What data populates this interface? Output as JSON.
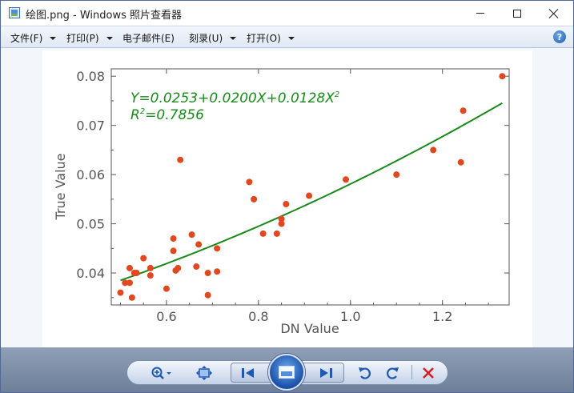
{
  "window": {
    "title": "绘图.png - Windows 照片查看器"
  },
  "menu": {
    "items": [
      {
        "label": "文件(F)"
      },
      {
        "label": "打印(P)"
      },
      {
        "label": "电子邮件(E)"
      },
      {
        "label": "刻录(U)"
      },
      {
        "label": "打开(O)"
      }
    ]
  },
  "toolbar": {
    "icons": [
      "zoom-icon",
      "fit-window-icon",
      "previous-icon",
      "slideshow-icon",
      "next-icon",
      "rotate-counterclockwise-icon",
      "rotate-clockwise-icon",
      "delete-icon"
    ]
  },
  "chart_data": {
    "type": "scatter",
    "xlabel": "DN Value",
    "ylabel": "True Value",
    "xlim": [
      0.48,
      1.345
    ],
    "ylim": [
      0.0335,
      0.0815
    ],
    "xticks": [
      "0.6",
      "0.8",
      "1.0",
      "1.2"
    ],
    "yticks": [
      "0.04",
      "0.05",
      "0.06",
      "0.07",
      "0.08"
    ],
    "equation": "Y=0.0253+0.0200X+0.0128X",
    "equation_sup": "2",
    "r2_prefix": "R",
    "r2_sup": "2",
    "r2_value": "=0.7856",
    "colors": {
      "points": "#e0491f",
      "fit": "#1a8a1a",
      "annotation": "#1a8a1a",
      "axis": "#555555"
    },
    "fit": {
      "a": 0.0253,
      "b": 0.02,
      "c": 0.0128,
      "x_from": 0.5,
      "x_to": 1.33
    },
    "points": [
      [
        0.5,
        0.036
      ],
      [
        0.51,
        0.038
      ],
      [
        0.52,
        0.041
      ],
      [
        0.52,
        0.038
      ],
      [
        0.525,
        0.035
      ],
      [
        0.53,
        0.04
      ],
      [
        0.535,
        0.04
      ],
      [
        0.55,
        0.043
      ],
      [
        0.565,
        0.0395
      ],
      [
        0.565,
        0.041
      ],
      [
        0.6,
        0.0368
      ],
      [
        0.615,
        0.0445
      ],
      [
        0.615,
        0.047
      ],
      [
        0.62,
        0.0405
      ],
      [
        0.625,
        0.041
      ],
      [
        0.63,
        0.063
      ],
      [
        0.655,
        0.0478
      ],
      [
        0.665,
        0.0413
      ],
      [
        0.67,
        0.0458
      ],
      [
        0.69,
        0.04
      ],
      [
        0.69,
        0.0355
      ],
      [
        0.71,
        0.0403
      ],
      [
        0.71,
        0.045
      ],
      [
        0.78,
        0.0585
      ],
      [
        0.79,
        0.055
      ],
      [
        0.81,
        0.048
      ],
      [
        0.84,
        0.048
      ],
      [
        0.85,
        0.05
      ],
      [
        0.85,
        0.051
      ],
      [
        0.86,
        0.054
      ],
      [
        0.91,
        0.0557
      ],
      [
        0.99,
        0.059
      ],
      [
        1.1,
        0.06
      ],
      [
        1.18,
        0.065
      ],
      [
        1.24,
        0.0625
      ],
      [
        1.245,
        0.073
      ],
      [
        1.33,
        0.08
      ]
    ]
  }
}
